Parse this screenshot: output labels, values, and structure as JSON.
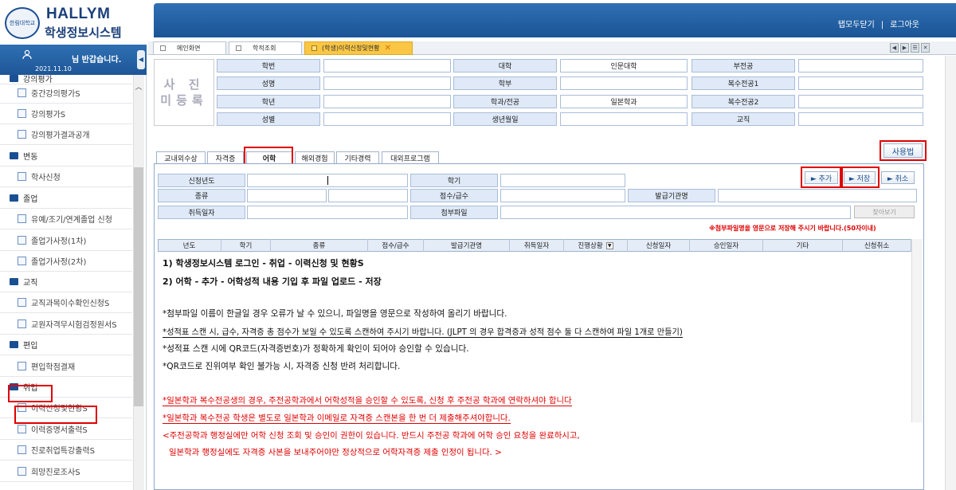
{
  "header": {
    "logo_en": "HALLYM",
    "logo_ko": "학생정보시스템",
    "seal_text": "한림대학교",
    "links": [
      "탭모두닫기",
      "로그아웃"
    ],
    "link_sep": "|"
  },
  "user": {
    "welcome": "님 반갑습니다.",
    "date": "2021.11.10",
    "collapse_glyph": "◀"
  },
  "sidebar": {
    "items": [
      {
        "label": "강의평가",
        "kind": "cat"
      },
      {
        "label": "중간강의평가S",
        "kind": "sub"
      },
      {
        "label": "강의평가S",
        "kind": "sub"
      },
      {
        "label": "강의평가결과공개",
        "kind": "sub"
      },
      {
        "label": "변동",
        "kind": "cat"
      },
      {
        "label": "학사신청",
        "kind": "sub"
      },
      {
        "label": "졸업",
        "kind": "cat"
      },
      {
        "label": "유예/조기/연계졸업 신청",
        "kind": "sub"
      },
      {
        "label": "졸업가사정(1차)",
        "kind": "sub"
      },
      {
        "label": "졸업가사정(2차)",
        "kind": "sub"
      },
      {
        "label": "교직",
        "kind": "cat"
      },
      {
        "label": "교직과목이수확인신청S",
        "kind": "sub"
      },
      {
        "label": "교원자격무시험검정원서S",
        "kind": "sub"
      },
      {
        "label": "편입",
        "kind": "cat"
      },
      {
        "label": "편입학점결재",
        "kind": "sub"
      },
      {
        "label": "취업",
        "kind": "cat"
      },
      {
        "label": "이력신청및현황S",
        "kind": "sub"
      },
      {
        "label": "이력증명서출력S",
        "kind": "sub"
      },
      {
        "label": "진로취업특강출력S",
        "kind": "sub"
      },
      {
        "label": "희망진로조사S",
        "kind": "sub"
      }
    ]
  },
  "tabs": [
    {
      "label": "메인화면"
    },
    {
      "label": "학적조회"
    },
    {
      "label": "(학생)이력신청및현황"
    }
  ],
  "tab_close": "✕",
  "window_controls": [
    "◀",
    "▶",
    "☰",
    "✕"
  ],
  "photo": {
    "text": "사 진\n미등록"
  },
  "student_info": {
    "rows": [
      [
        {
          "label": "학번",
          "value": ""
        },
        {
          "label": "대학",
          "value": "인문대학"
        },
        {
          "label": "부전공",
          "value": ""
        }
      ],
      [
        {
          "label": "성명",
          "value": ""
        },
        {
          "label": "학부",
          "value": ""
        },
        {
          "label": "복수전공1",
          "value": ""
        }
      ],
      [
        {
          "label": "학년",
          "value": ""
        },
        {
          "label": "학과/전공",
          "value": "일본학과"
        },
        {
          "label": "복수전공2",
          "value": ""
        }
      ],
      [
        {
          "label": "성별",
          "value": ""
        },
        {
          "label": "생년월일",
          "value": ""
        },
        {
          "label": "교직",
          "value": ""
        }
      ]
    ]
  },
  "subtabs": [
    "교내외수상",
    "자격증",
    "어학",
    "해외경험",
    "기타경력",
    "대외프로그램"
  ],
  "usage_button": "사용법",
  "form": {
    "apply_year": "신청년도",
    "semester": "학기",
    "type": "종류",
    "score": "점수/급수",
    "issuer": "발급기관명",
    "acquired_date": "취득일자",
    "attachment": "첨부파일",
    "find_button": "찾아보기",
    "add_button": "► 추가",
    "save_button": "► 저장",
    "cancel_button": "► 취소",
    "note": "※첨부파일명을 영문으로 저장해 주시기 바랍니다.(50자이내)"
  },
  "grid": {
    "columns": [
      "년도",
      "학기",
      "종류",
      "점수/급수",
      "발급기관명",
      "취득일자",
      "진행상황",
      "신청일자",
      "승인일자",
      "기타",
      "신청취소"
    ],
    "dropdown_glyph": "▼"
  },
  "instructions": [
    "1) 학생정보시스템 로그인 - 취업 - 이력신청 및 현황S",
    "2) 어학 - 추가 - 어학성적 내용 기입 후 파일 업로드 - 저장",
    "*첨부파일 이름이 한글일 경우 오류가 날 수 있으니, 파일명을 영문으로 작성하여 올리기 바랍니다.",
    "*성적표 스캔 시, 급수, 자격증 총 점수가 보일 수 있도록 스캔하여 주시기 바랍니다. (JLPT 의 경우 합격증과 성적 점수 둘 다 스캔하여 파일 1개로 만들기)",
    "*성적표 스캔 시에 QR코드(자격증번호)가 정확하게 확인이 되어야 승인할 수 있습니다.",
    "*QR코드로 진위여부 확인 불가능 시, 자격증 신청 반려 처리합니다.",
    "*일본학과 복수전공생의 경우, 주전공학과에서 어학성적을 승인할 수 있도록, 신청 후 주전공 학과에 연락하셔야 합니다",
    "*일본학과 복수전공 학생은 별도로 일본학과 이메일로 자격증 스캔본을 한 번 더 제출해주셔야합니다.",
    "<주전공학과 행정실에만 어학 신청 조회 및 승인이 권한이 있습니다. 반드시 주전공 학과에 어학 승인 요청을 완료하시고,",
    "일본학과 행정실에도 자격증 사본을 보내주어야만 정상적으로 어학자격증 제출 인정이 됩니다. >"
  ],
  "colors": {
    "accent": "#1d5697",
    "highlight": "#e00000",
    "active_tab": "#f9c645"
  }
}
